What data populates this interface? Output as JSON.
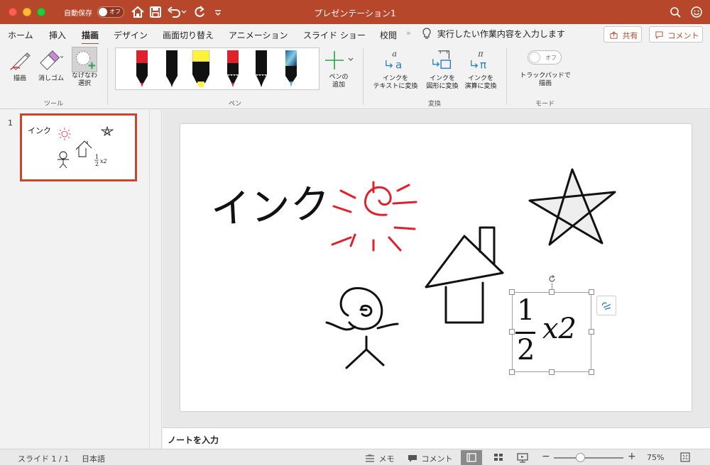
{
  "titlebar": {
    "autosave_label": "自動保存",
    "autosave_state": "オフ",
    "title": "プレゼンテーション1"
  },
  "tabs": [
    "ホーム",
    "挿入",
    "描画",
    "デザイン",
    "画面切り替え",
    "アニメーション",
    "スライド ショー",
    "校閲"
  ],
  "active_tab": "描画",
  "tell_me": "実行したい作業内容を入力します",
  "share_label": "共有",
  "comment_label": "コメント",
  "ribbon": {
    "tools": {
      "draw": "描画",
      "eraser": "消しゴム",
      "lasso_line1": "なげなわ",
      "lasso_line2": "選択",
      "group": "ツール"
    },
    "pens": {
      "group": "ペン",
      "add_line1": "ペンの",
      "add_line2": "追加"
    },
    "convert": {
      "to_text_line1": "インクを",
      "to_text_line2": "テキストに変換",
      "to_shape_line1": "インクを",
      "to_shape_line2": "図形に変換",
      "to_math_line1": "インクを",
      "to_math_line2": "演算に変換",
      "group": "変換"
    },
    "mode": {
      "toggle_state": "オフ",
      "trackpad_line1": "トラックパッドで",
      "trackpad_line2": "描画",
      "group": "モード"
    }
  },
  "thumbnail": {
    "number": "1",
    "ink_text": "インク"
  },
  "slide": {
    "ink_text": "インク",
    "math_numerator": "1",
    "math_denominator": "2",
    "math_rest": "x2"
  },
  "notes_placeholder": "ノートを入力",
  "statusbar": {
    "slide_info": "スライド 1 / 1",
    "language": "日本語",
    "notes_label": "メモ",
    "comments_label": "コメント",
    "zoom_minus": "−",
    "zoom_plus": "+",
    "zoom_level": "75%",
    "zoom_fraction": 0.38
  },
  "colors": {
    "accent": "#b7472a",
    "pen_red": "#e0202a",
    "pen_yellow": "#fff23a"
  }
}
